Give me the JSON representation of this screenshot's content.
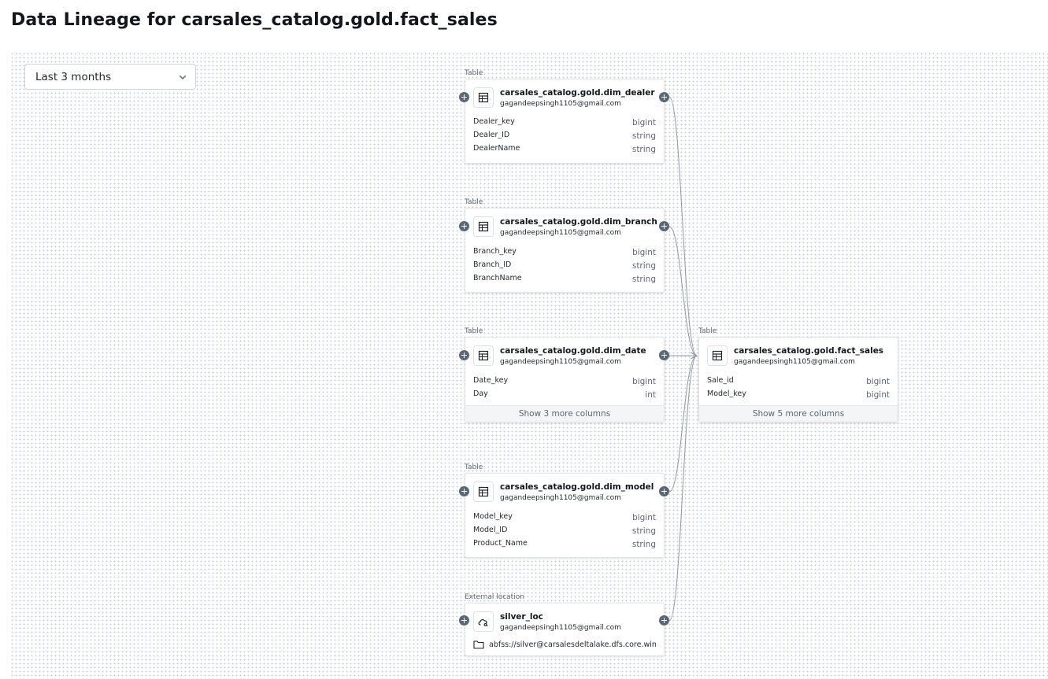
{
  "header": {
    "title": "Data Lineage for carsales_catalog.gold.fact_sales"
  },
  "filter": {
    "selected": "Last 3 months"
  },
  "colors": {
    "connector": "#8c99a6",
    "expand_button": "#5a6875"
  },
  "nodes": {
    "dim_dealer": {
      "type_label": "Table",
      "name": "carsales_catalog.gold.dim_dealer",
      "owner": "gagandeepsingh1105@gmail.com",
      "columns": [
        {
          "name": "Dealer_key",
          "type": "bigint"
        },
        {
          "name": "Dealer_ID",
          "type": "string"
        },
        {
          "name": "DealerName",
          "type": "string"
        }
      ]
    },
    "dim_branch": {
      "type_label": "Table",
      "name": "carsales_catalog.gold.dim_branch",
      "owner": "gagandeepsingh1105@gmail.com",
      "columns": [
        {
          "name": "Branch_key",
          "type": "bigint"
        },
        {
          "name": "Branch_ID",
          "type": "string"
        },
        {
          "name": "BranchName",
          "type": "string"
        }
      ]
    },
    "dim_date": {
      "type_label": "Table",
      "name": "carsales_catalog.gold.dim_date",
      "owner": "gagandeepsingh1105@gmail.com",
      "columns": [
        {
          "name": "Date_key",
          "type": "bigint"
        },
        {
          "name": "Day",
          "type": "int"
        }
      ],
      "more_label": "Show 3 more columns"
    },
    "dim_model": {
      "type_label": "Table",
      "name": "carsales_catalog.gold.dim_model",
      "owner": "gagandeepsingh1105@gmail.com",
      "columns": [
        {
          "name": "Model_key",
          "type": "bigint"
        },
        {
          "name": "Model_ID",
          "type": "string"
        },
        {
          "name": "Product_Name",
          "type": "string"
        }
      ]
    },
    "silver_loc": {
      "type_label": "External location",
      "name": "silver_loc",
      "owner": "gagandeepsingh1105@gmail.com",
      "path": "abfss://silver@carsalesdeltalake.dfs.core.wind..."
    },
    "fact_sales": {
      "type_label": "Table",
      "name": "carsales_catalog.gold.fact_sales",
      "owner": "gagandeepsingh1105@gmail.com",
      "columns": [
        {
          "name": "Sale_id",
          "type": "bigint"
        },
        {
          "name": "Model_key",
          "type": "bigint"
        }
      ],
      "more_label": "Show 5 more columns"
    }
  }
}
